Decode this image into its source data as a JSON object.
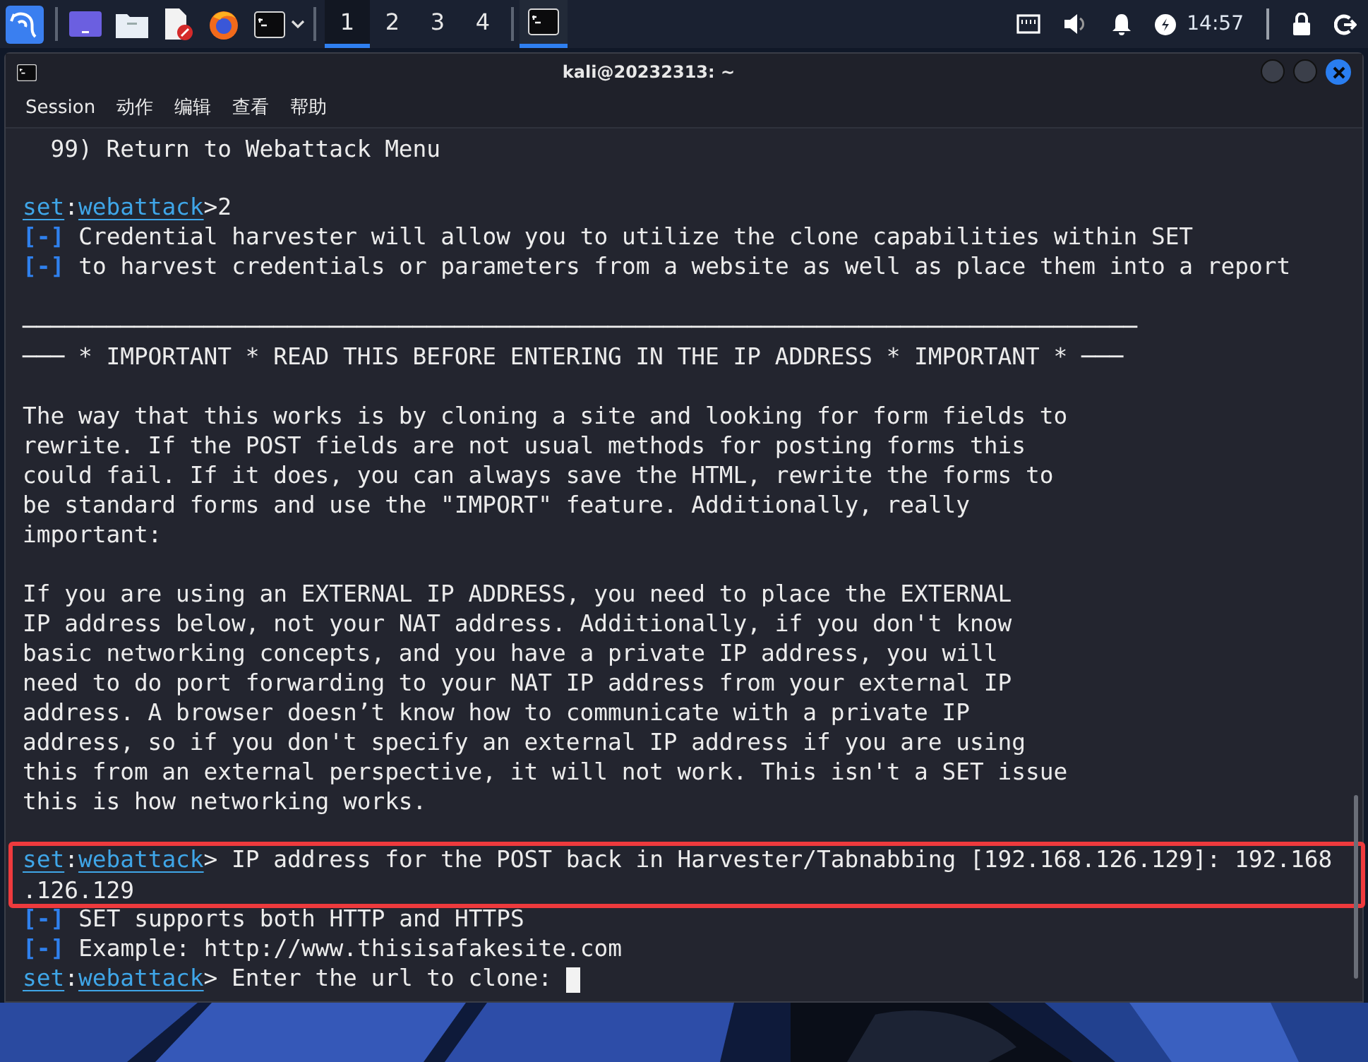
{
  "panel": {
    "workspaces": [
      {
        "label": "1",
        "selected": true
      },
      {
        "label": "2",
        "selected": false
      },
      {
        "label": "3",
        "selected": false
      },
      {
        "label": "4",
        "selected": false
      }
    ],
    "task": {
      "selected": true
    },
    "clock": "14:57"
  },
  "window": {
    "title": "kali@20232313: ~"
  },
  "menu": [
    "Session",
    "动作",
    "编辑",
    "查看",
    "帮助"
  ],
  "lines": [
    {
      "kind": "text",
      "text": "  99) Return to Webattack Menu"
    },
    {
      "kind": "blank"
    },
    {
      "kind": "prompt",
      "segments": [
        {
          "text": "set",
          "link": true
        },
        {
          "text": ":",
          "link": false
        },
        {
          "text": "webattack",
          "link": true
        },
        {
          "text": ">2",
          "link": false
        }
      ]
    },
    {
      "kind": "info",
      "marker": "[-]",
      "text": "Credential harvester will allow you to utilize the clone capabilities within SET"
    },
    {
      "kind": "info",
      "marker": "[-]",
      "text": "to harvest credentials or parameters from a website as well as place them into a report"
    },
    {
      "kind": "blank"
    },
    {
      "kind": "text",
      "text": "────────────────────────────────────────────────────────────────────────────────"
    },
    {
      "kind": "text",
      "text": "─── * IMPORTANT * READ THIS BEFORE ENTERING IN THE IP ADDRESS * IMPORTANT * ───"
    },
    {
      "kind": "blank"
    },
    {
      "kind": "text",
      "text": "The way that this works is by cloning a site and looking for form fields to"
    },
    {
      "kind": "text",
      "text": "rewrite. If the POST fields are not usual methods for posting forms this"
    },
    {
      "kind": "text",
      "text": "could fail. If it does, you can always save the HTML, rewrite the forms to"
    },
    {
      "kind": "text",
      "text": "be standard forms and use the \"IMPORT\" feature. Additionally, really"
    },
    {
      "kind": "text",
      "text": "important:"
    },
    {
      "kind": "blank"
    },
    {
      "kind": "text",
      "text": "If you are using an EXTERNAL IP ADDRESS, you need to place the EXTERNAL"
    },
    {
      "kind": "text",
      "text": "IP address below, not your NAT address. Additionally, if you don't know"
    },
    {
      "kind": "text",
      "text": "basic networking concepts, and you have a private IP address, you will"
    },
    {
      "kind": "text",
      "text": "need to do port forwarding to your NAT IP address from your external IP"
    },
    {
      "kind": "text",
      "text": "address. A browser doesn’t know how to communicate with a private IP"
    },
    {
      "kind": "text",
      "text": "address, so if you don't specify an external IP address if you are using"
    },
    {
      "kind": "text",
      "text": "this from an external perspective, it will not work. This isn't a SET issue"
    },
    {
      "kind": "text",
      "text": "this is how networking works."
    },
    {
      "kind": "blank"
    },
    {
      "kind": "prompt",
      "highlighted": true,
      "segments": [
        {
          "text": "set",
          "link": true
        },
        {
          "text": ":",
          "link": false
        },
        {
          "text": "webattack",
          "link": true
        },
        {
          "text": "> IP address for the POST back in Harvester/Tabnabbing [192.168.126.129]: 192.168",
          "link": false
        }
      ]
    },
    {
      "kind": "text",
      "highlighted": true,
      "text": ".126.129"
    },
    {
      "kind": "info",
      "marker": "[-]",
      "text": "SET supports both HTTP and HTTPS"
    },
    {
      "kind": "info",
      "marker": "[-]",
      "text": "Example: http://www.thisisafakesite.com"
    },
    {
      "kind": "prompt",
      "cursor": true,
      "segments": [
        {
          "text": "set",
          "link": true
        },
        {
          "text": ":",
          "link": false
        },
        {
          "text": "webattack",
          "link": true
        },
        {
          "text": "> Enter the url to clone: ",
          "link": false
        }
      ]
    }
  ]
}
